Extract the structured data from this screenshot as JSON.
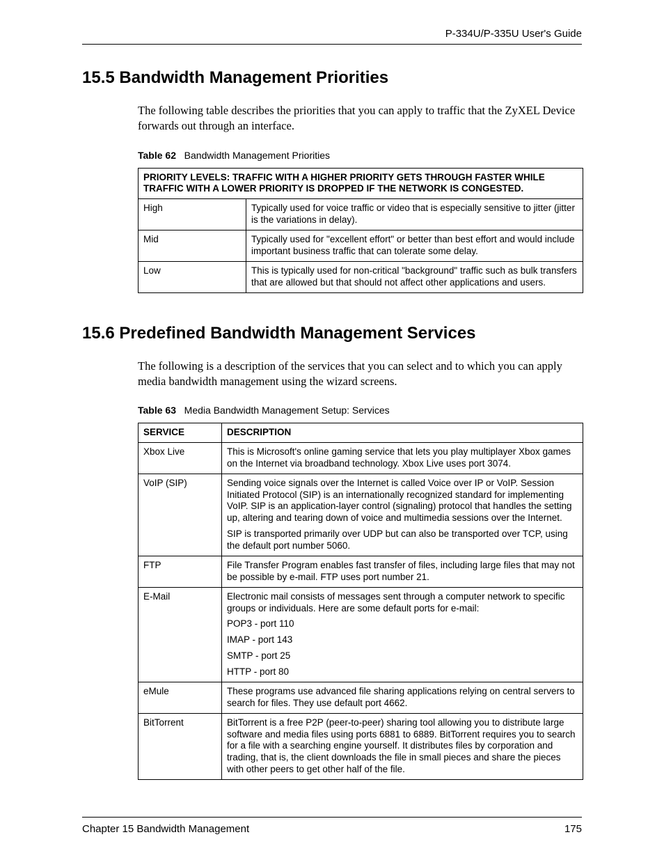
{
  "header": {
    "guide": "P-334U/P-335U User's Guide"
  },
  "sections": {
    "s155": {
      "title": "15.5  Bandwidth Management Priorities",
      "intro": "The following table describes the priorities that you can apply to traffic that the ZyXEL Device forwards out through an interface."
    },
    "s156": {
      "title": "15.6  Predefined Bandwidth Management Services",
      "intro": "The following is a description of the services that you can select and to which you can apply media bandwidth management using the wizard screens."
    }
  },
  "table62": {
    "label": "Table 62",
    "caption": "Bandwidth Management Priorities",
    "levels_header": "PRIORITY LEVELS: TRAFFIC WITH A HIGHER PRIORITY GETS THROUGH FASTER WHILE TRAFFIC WITH A LOWER PRIORITY IS DROPPED IF THE NETWORK IS CONGESTED.",
    "rows": [
      {
        "level": "High",
        "desc": "Typically used for voice traffic or video that is especially sensitive to jitter (jitter is the variations in delay)."
      },
      {
        "level": "Mid",
        "desc": "Typically used for \"excellent effort\" or better than best effort and would include important business traffic that can tolerate some delay."
      },
      {
        "level": "Low",
        "desc": "This is typically used for non-critical \"background\" traffic such as bulk transfers that are allowed but that should not affect other applications and users."
      }
    ]
  },
  "table63": {
    "label": "Table 63",
    "caption": "Media Bandwidth Management Setup: Services",
    "headers": {
      "service": "SERVICE",
      "description": "DESCRIPTION"
    },
    "rows": {
      "xboxlive": {
        "service": "Xbox Live",
        "p1": "This is Microsoft's online gaming service that lets you play multiplayer Xbox games on the Internet via broadband technology. Xbox Live uses port 3074."
      },
      "voip": {
        "service": "VoIP (SIP)",
        "p1": "Sending voice signals over the Internet is called Voice over IP or VoIP. Session Initiated Protocol  (SIP) is an internationally recognized standard for implementing VoIP. SIP is an application-layer control (signaling) protocol that handles the setting up, altering and tearing down of voice and multimedia sessions over the Internet.",
        "p2": "SIP is transported primarily over UDP but can also be transported over TCP, using the default port number 5060."
      },
      "ftp": {
        "service": "FTP",
        "p1": "File Transfer Program enables fast transfer of files, including large files that may not be possible by e-mail. FTP uses port number 21."
      },
      "email": {
        "service": "E-Mail",
        "p1": "Electronic mail consists of messages sent through a computer network to specific groups or individuals. Here are some default ports for e-mail:",
        "p2": "POP3 - port 110",
        "p3": "IMAP - port 143",
        "p4": "SMTP - port 25",
        "p5": "HTTP - port 80"
      },
      "emule": {
        "service": "eMule",
        "p1": "These programs use advanced file sharing applications relying on central servers to search for files. They use default port 4662."
      },
      "bt": {
        "service": "BitTorrent",
        "p1": "BitTorrent is a free P2P (peer-to-peer) sharing tool allowing you to distribute large software and media files using ports 6881 to 6889. BitTorrent requires you to search for a file with a searching engine yourself. It distributes files by corporation and trading, that is, the client downloads the file in small pieces and share the pieces with other peers to get other half of the file."
      }
    }
  },
  "footer": {
    "chapter": "Chapter 15 Bandwidth Management",
    "page": "175"
  }
}
